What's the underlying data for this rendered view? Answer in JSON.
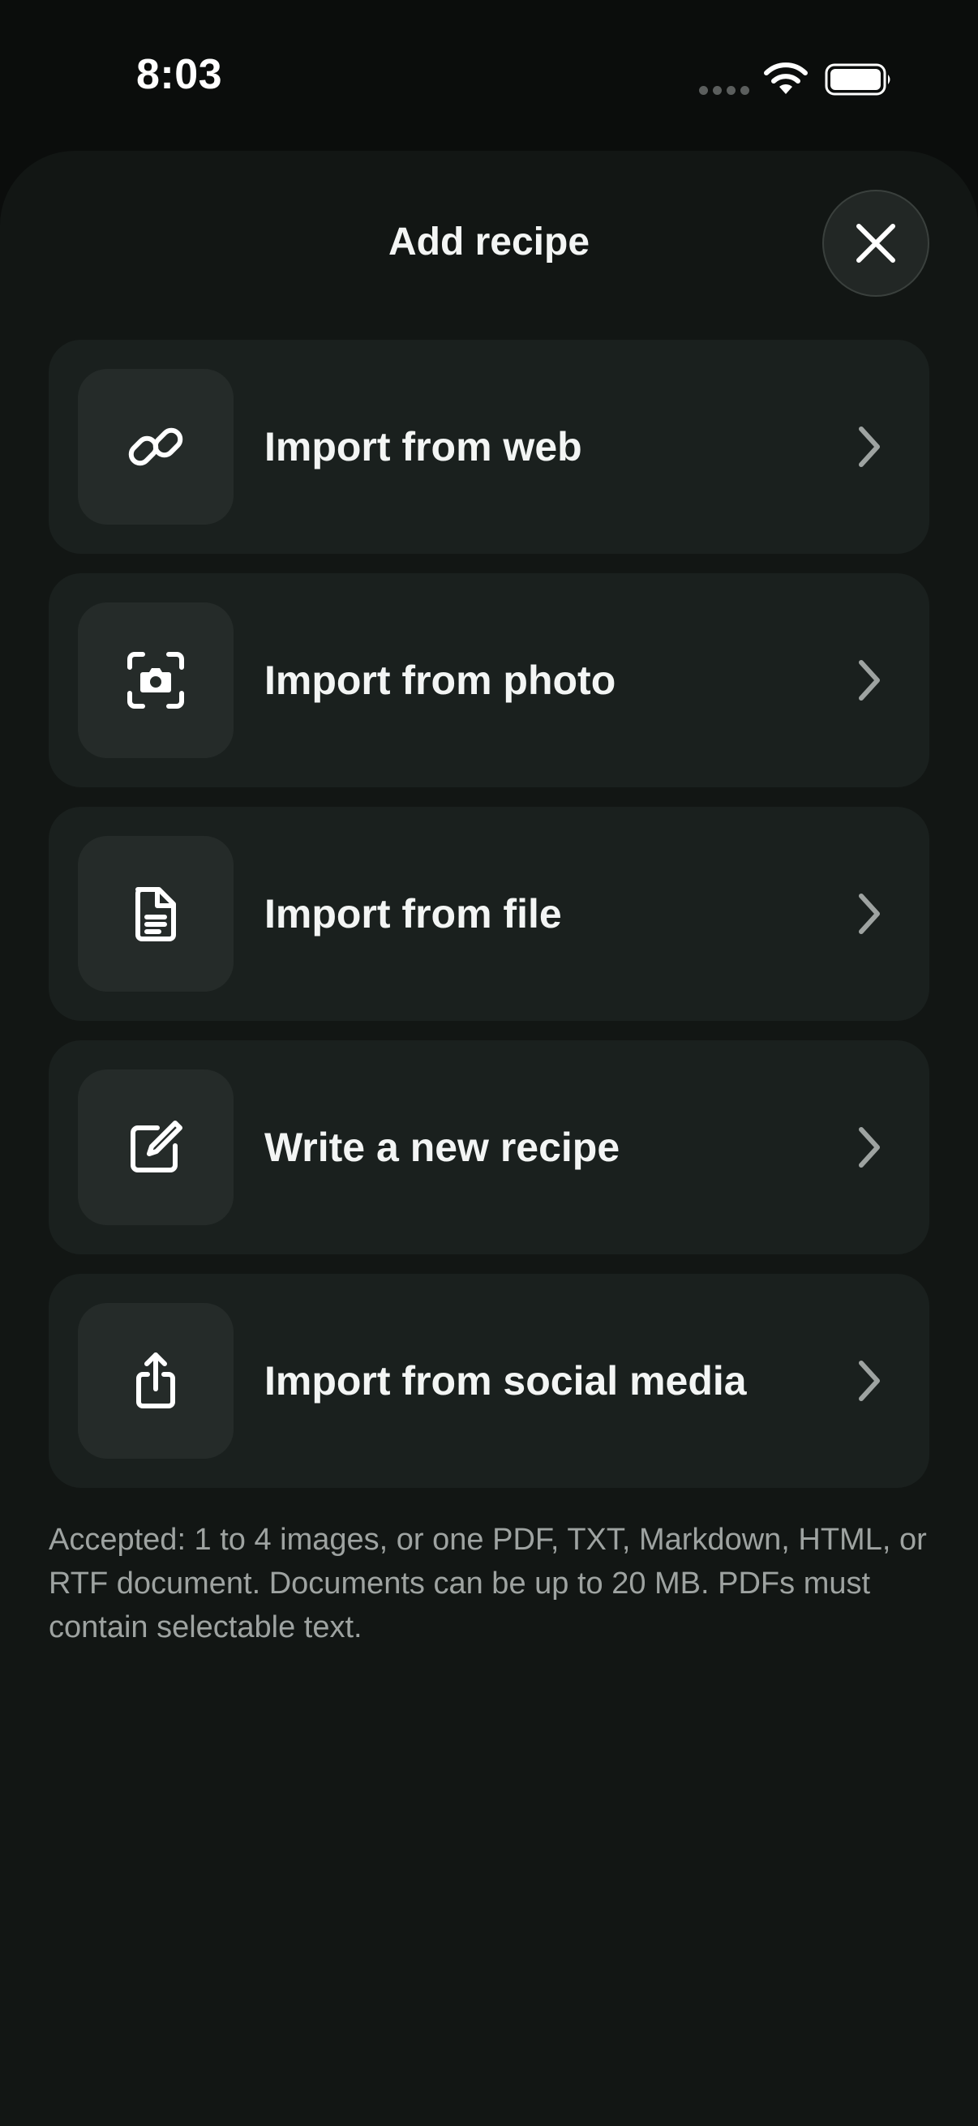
{
  "status_bar": {
    "time": "8:03"
  },
  "sheet": {
    "title": "Add recipe",
    "close_icon": "close-icon"
  },
  "options": [
    {
      "label": "Import from web",
      "icon": "link-icon"
    },
    {
      "label": "Import from photo",
      "icon": "camera-scan-icon"
    },
    {
      "label": "Import from file",
      "icon": "document-icon"
    },
    {
      "label": "Write a new recipe",
      "icon": "compose-icon"
    },
    {
      "label": "Import from social media",
      "icon": "share-icon"
    }
  ],
  "footnote": "Accepted: 1 to 4 images, or one PDF, TXT, Markdown, HTML, or RTF document. Documents can be up to 20 MB. PDFs must contain selectable text.",
  "colors": {
    "background": "#0b0d0c",
    "sheet": "#121614",
    "card": "#1a201e",
    "icon_box": "#252b29",
    "text": "#f3f5f4",
    "muted_text": "#9ea3a1"
  }
}
